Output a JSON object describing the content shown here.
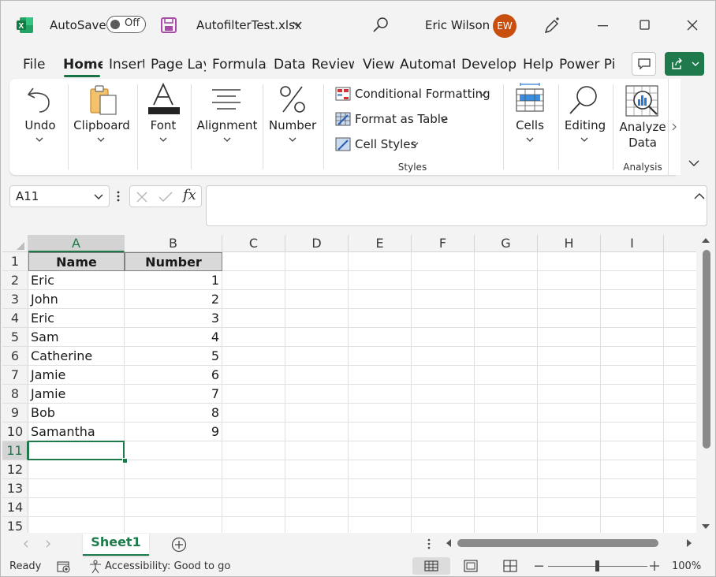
{
  "titlebar": {
    "autosave_label": "AutoSave",
    "autosave_state": "Off",
    "filename": "AutofilterTest.xlsx",
    "user_name": "Eric Wilson",
    "user_initials": "EW"
  },
  "tabs": [
    "File",
    "Home",
    "Insert",
    "Page Layout",
    "Formulas",
    "Data",
    "Review",
    "View",
    "Automate",
    "Developer",
    "Help",
    "Power Pivot"
  ],
  "active_tab": "Home",
  "ribbon": {
    "undo": "Undo",
    "clipboard": "Clipboard",
    "font": "Font",
    "alignment": "Alignment",
    "number": "Number",
    "conditional_formatting": "Conditional Formatting",
    "format_as_table": "Format as Table",
    "cell_styles": "Cell Styles",
    "styles_group": "Styles",
    "cells": "Cells",
    "editing": "Editing",
    "analyze_line1": "Analyze",
    "analyze_line2": "Data",
    "analysis_group": "Analysis"
  },
  "formula_bar": {
    "name_box": "A11",
    "fx": "fx",
    "formula": ""
  },
  "grid": {
    "columns": [
      "A",
      "B",
      "C",
      "D",
      "E",
      "F",
      "G",
      "H",
      "I"
    ],
    "rows": [
      "1",
      "2",
      "3",
      "4",
      "5",
      "6",
      "7",
      "8",
      "9",
      "10",
      "11",
      "12",
      "13",
      "14",
      "15"
    ],
    "header": [
      "Name",
      "Number"
    ],
    "data": [
      [
        "Eric",
        "1"
      ],
      [
        "John",
        "2"
      ],
      [
        "Eric",
        "3"
      ],
      [
        "Sam",
        "4"
      ],
      [
        "Catherine",
        "5"
      ],
      [
        "Jamie",
        "6"
      ],
      [
        "Jamie",
        "7"
      ],
      [
        "Bob",
        "8"
      ],
      [
        "Samantha",
        "9"
      ]
    ],
    "selected_cell": "A11"
  },
  "sheets": [
    "Sheet1"
  ],
  "status": {
    "ready": "Ready",
    "accessibility": "Accessibility: Good to go",
    "zoom": "100%"
  },
  "colors": {
    "accent": "#1e7a4b",
    "avatar": "#c94f0f"
  }
}
